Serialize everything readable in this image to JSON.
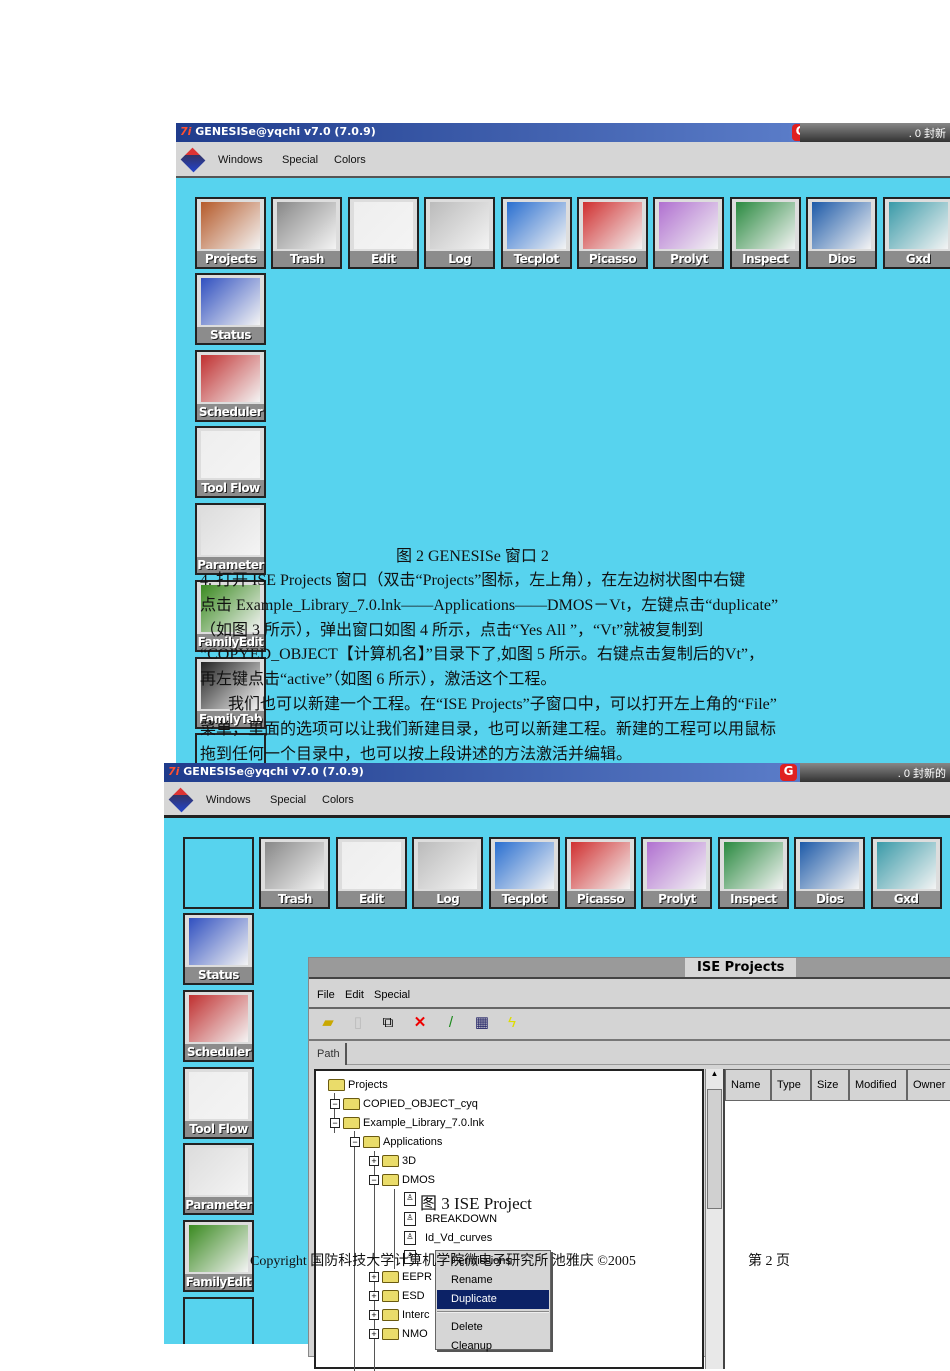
{
  "window1": {
    "title": "GENESISe@yqchi   v7.0 (7.0.9)",
    "title_logo": "7i",
    "tray_text": ". 0 封新",
    "menu": [
      "Windows",
      "Special",
      "Colors"
    ],
    "tiles_top": [
      "Projects",
      "Trash",
      "Edit",
      "Log",
      "Tecplot",
      "Picasso",
      "Prolyt",
      "Inspect",
      "Dios",
      "Gxd"
    ],
    "tiles_side": [
      "Status",
      "Scheduler",
      "Tool Flow",
      "Parameter",
      "FamilyEdit",
      "FamilyTab",
      ""
    ]
  },
  "doc": {
    "caption2": "图 2 GENESISe 窗口 2",
    "para1": [
      "4. 打开 ISE Projects  窗口（双击“Projects”图标，左上角），在左边树状图中右键",
      "点击 Example_Library_7.0.lnk——Applications——DMOS－Vt，左键点击“duplicate”",
      "（如图  3  所示），弹出窗口如图  4  所示，点击“Yes All  ”，“Vt”就被复制到",
      "“COPYED_OBJECT【计算机名】”目录下了,如图 5 所示。右键点击复制后的Vt”，",
      "再左键点击“active”（如图 6 所示），激活这个工程。"
    ],
    "para2": [
      "我们也可以新建一个工程。在“ISE Projects”子窗口中，可以打开左上角的“File”",
      "菜单，里面的选项可以让我们新建目录，也可以新建工程。新建的工程可以用鼠标",
      "拖到任何一个目录中，也可以按上段讲述的方法激活并编辑。"
    ],
    "caption3": "图 3 ISE Project",
    "footer_left": "Copyright 国防科技大学计算机学院微电子研究所   池雅庆   ©2005",
    "footer_right": "第 2 页"
  },
  "window2": {
    "title": "GENESISe@yqchi   v7.0 (7.0.9)",
    "title_logo": "7i",
    "tray_text": ". 0 封新的",
    "menu": [
      "Windows",
      "Special",
      "Colors"
    ],
    "tiles_top": [
      "",
      "Trash",
      "Edit",
      "Log",
      "Tecplot",
      "Picasso",
      "Prolyt",
      "Inspect",
      "Dios",
      "Gxd"
    ],
    "tiles_side": [
      "Status",
      "Scheduler",
      "Tool Flow",
      "Parameter",
      "FamilyEdit",
      ""
    ]
  },
  "ise": {
    "title": "ISE Projects",
    "menu": [
      "File",
      "Edit",
      "Special"
    ],
    "path_label": "Path",
    "path_value": "",
    "columns": [
      "Name",
      "Type",
      "Size",
      "Modified",
      "Owner"
    ],
    "tree": {
      "root": "Projects",
      "copied": "COPIED_OBJECT_cyq",
      "example": "Example_Library_7.0.lnk",
      "applications": "Applications",
      "d3": "3D",
      "dmos": "DMOS",
      "breakdown": "BREAKDOWN",
      "idvd": "Id_Vd_curves",
      "eepr": "EEPR",
      "esd": "ESD",
      "interc": "Interc",
      "nmo": "NMO"
    },
    "context_menu": [
      "Permissions",
      "Rename",
      "Duplicate",
      "Delete",
      "Cleanup"
    ],
    "selected_menu_item": "Duplicate"
  }
}
